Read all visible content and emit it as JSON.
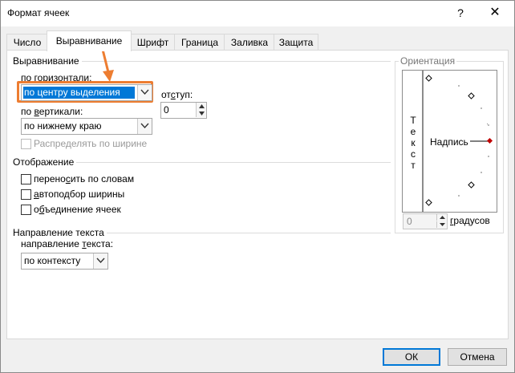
{
  "window": {
    "title": "Формат ячеек",
    "help": "?",
    "close": "✕"
  },
  "tabs": [
    {
      "label": "Число",
      "active": false
    },
    {
      "label": "Выравнивание",
      "active": true
    },
    {
      "label": "Шрифт",
      "active": false
    },
    {
      "label": "Граница",
      "active": false
    },
    {
      "label": "Заливка",
      "active": false
    },
    {
      "label": "Защита",
      "active": false
    }
  ],
  "alignment": {
    "group_label": "Выравнивание",
    "horizontal_label": "по горизонтали:",
    "horizontal_value": "по центру выделения",
    "indent_label": "отступ:",
    "indent_value": "0",
    "vertical_label": "по вертикали:",
    "vertical_value": "по нижнему краю",
    "justify_distributed_label": "Распределять по ширине"
  },
  "display": {
    "group_label": "Отображение",
    "wrap_text": "переносить по словам",
    "shrink_to_fit": "автоподбор ширины",
    "merge_cells": "объединение ячеек"
  },
  "direction": {
    "group_label": "Направление текста",
    "label": "направление текста:",
    "value": "по контексту"
  },
  "orientation": {
    "group_label": "Ориентация",
    "vertical_text": "Текст",
    "dial_label": "Надпись",
    "degrees_value": "0",
    "degrees_label": "градусов"
  },
  "buttons": {
    "ok": "ОК",
    "cancel": "Отмена"
  },
  "colors": {
    "accent": "#ed7d31",
    "selection": "#0078d7",
    "dial_marker": "#c00000"
  },
  "icons": [
    "close-icon",
    "help-icon",
    "chevron-down-icon",
    "arrow-down-icon",
    "spin-up-icon",
    "spin-down-icon"
  ]
}
